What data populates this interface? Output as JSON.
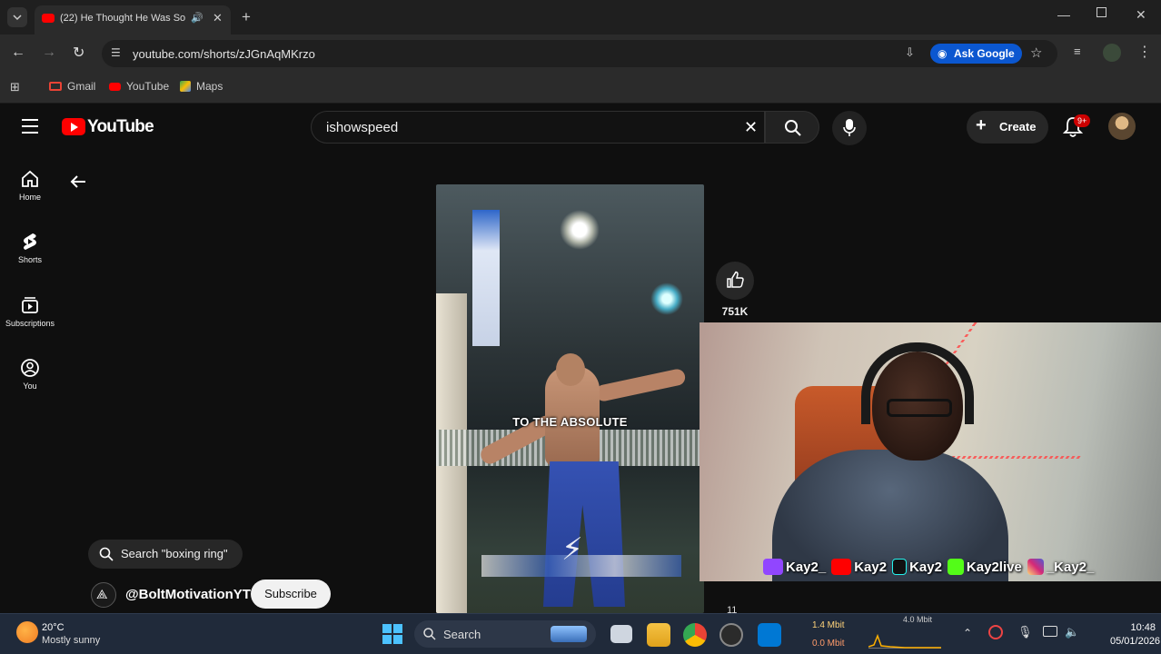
{
  "browser": {
    "tab_title": "(22) He Thought He Was So",
    "url": "youtube.com/shorts/zJGnAqMKrzo",
    "ask_google": "Ask Google",
    "bookmarks": [
      {
        "label": "Gmail",
        "icon": "gmail-icon",
        "color": "#ea4335"
      },
      {
        "label": "YouTube",
        "icon": "youtube-icon",
        "color": "#ff0000"
      },
      {
        "label": "Maps",
        "icon": "maps-icon",
        "color": "#34a853"
      }
    ]
  },
  "youtube": {
    "logo_text": "YouTube",
    "search_value": "ishowspeed",
    "create_label": "Create",
    "notification_badge": "9+",
    "sidebar": [
      {
        "label": "Home",
        "icon": "home-icon"
      },
      {
        "label": "Shorts",
        "icon": "shorts-icon"
      },
      {
        "label": "Subscriptions",
        "icon": "subscriptions-icon"
      },
      {
        "label": "You",
        "icon": "you-icon"
      }
    ],
    "short": {
      "caption": "TO THE ABSOLUTE",
      "like_count": "751K",
      "second_count": "11",
      "search_suggestion": "Search \"boxing ring\"",
      "channel": "@BoltMotivationYT",
      "subscribe_label": "Subscribe"
    }
  },
  "webcam": {
    "socials": [
      {
        "platform": "twitch",
        "handle": "Kay2_",
        "color": "#9146ff"
      },
      {
        "platform": "youtube",
        "handle": "Kay2",
        "color": "#ff0000"
      },
      {
        "platform": "tiktok",
        "handle": "Kay2",
        "color": "#111111"
      },
      {
        "platform": "kick",
        "handle": "Kay2live",
        "color": "#53fc18"
      },
      {
        "platform": "instagram",
        "handle": "_Kay2_",
        "color": "#d62976"
      }
    ]
  },
  "taskbar": {
    "temperature": "20°C",
    "weather": "Mostly sunny",
    "search_label": "Search",
    "net_up": "1.4 Mbit",
    "net_down": "0.0 Mbit",
    "net_peak": "4.0 Mbit",
    "time": "10:48",
    "date": "05/01/2026"
  },
  "colors": {
    "youtube_red": "#ff0000",
    "page_bg": "#0f0f0f",
    "accent_blue": "#0b57d0"
  }
}
